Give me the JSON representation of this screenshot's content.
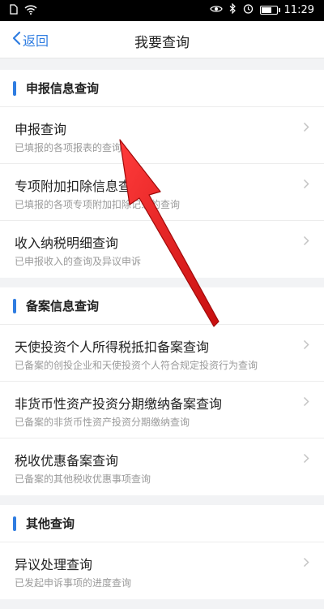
{
  "status_bar": {
    "time": "11:29",
    "icons": [
      "sim-card-icon",
      "wifi-icon",
      "eye-icon",
      "bluetooth-icon",
      "alarm-icon",
      "battery-icon"
    ],
    "battery_level_percent": 70
  },
  "nav": {
    "back_label": "返回",
    "title": "我要查询"
  },
  "sections": [
    {
      "title": "申报信息查询",
      "items": [
        {
          "title": "申报查询",
          "desc": "已填报的各项报表的查询"
        },
        {
          "title": "专项附加扣除信息查询",
          "desc": "已填报的各项专项附加扣除记录的查询"
        },
        {
          "title": "收入纳税明细查询",
          "desc": "已申报收入的查询及异议申诉"
        }
      ]
    },
    {
      "title": "备案信息查询",
      "items": [
        {
          "title": "天使投资个人所得税抵扣备案查询",
          "desc": "已备案的创投企业和天使投资个人符合规定投资行为查询"
        },
        {
          "title": "非货币性资产投资分期缴纳备案查询",
          "desc": "已备案的非货币性资产投资分期缴纳查询"
        },
        {
          "title": "税收优惠备案查询",
          "desc": "已备案的其他税收优惠事项查询"
        }
      ]
    },
    {
      "title": "其他查询",
      "items": [
        {
          "title": "异议处理查询",
          "desc": "已发起申诉事项的进度查询"
        }
      ]
    }
  ],
  "colors": {
    "accent": "#2f7de1",
    "annotation_arrow": "#e01b1b"
  }
}
